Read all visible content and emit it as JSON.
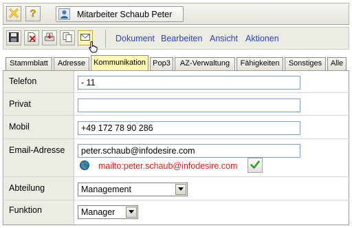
{
  "header": {
    "title": "Mitarbeiter Schaub Peter",
    "close_icon": "close-icon",
    "help_icon": "help-icon",
    "person_icon": "person-icon"
  },
  "toolbar": {
    "buttons": [
      "save-icon",
      "delete-icon",
      "print-icon",
      "copy-icon",
      "mail-icon"
    ],
    "menu": [
      "Dokument",
      "Bearbeiten",
      "Ansicht",
      "Aktionen"
    ]
  },
  "tabs": [
    "Stammblatt",
    "Adresse",
    "Kommunikation",
    "Pop3",
    "AZ-Verwaltung",
    "Fähigkeiten",
    "Sonstiges",
    "Alle"
  ],
  "active_tab": "Kommunikation",
  "form": {
    "telefon_label": "Telefon",
    "telefon_value": "- 11",
    "privat_label": "Privat",
    "privat_value": "",
    "mobil_label": "Mobil",
    "mobil_value": "+49 172 78 90 286",
    "email_label": "Email-Adresse",
    "email_value": "peter.schaub@infodesire.com",
    "mailto_link": "mailto:peter.schaub@infodesire.com",
    "abteilung_label": "Abteilung",
    "abteilung_value": "Management",
    "funktion_label": "Funktion",
    "funktion_value": "Manager"
  },
  "colors": {
    "menu_link": "#2a45b8",
    "active_tab": "#fff7b3",
    "mailto": "#e01b1b",
    "label_column": "#ecebe4"
  }
}
